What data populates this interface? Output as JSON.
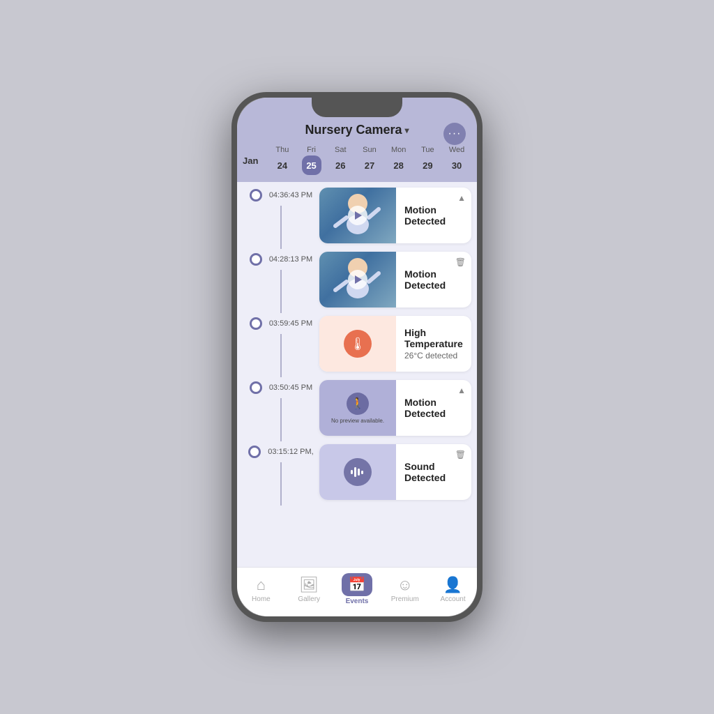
{
  "header": {
    "title": "Nursery Camera",
    "more_label": "•••"
  },
  "calendar": {
    "month": "Jan",
    "days": [
      {
        "name": "Thu",
        "num": "24",
        "active": false
      },
      {
        "name": "Fri",
        "num": "25",
        "active": true
      },
      {
        "name": "Sat",
        "num": "26",
        "active": false
      },
      {
        "name": "Sun",
        "num": "27",
        "active": false
      },
      {
        "name": "Mon",
        "num": "28",
        "active": false
      },
      {
        "name": "Tue",
        "num": "29",
        "active": false
      },
      {
        "name": "Wed",
        "num": "30",
        "active": false
      }
    ]
  },
  "events": [
    {
      "time": "04:36:43 PM",
      "type": "motion",
      "title": "Motion Detected",
      "has_video": true,
      "action": "▲"
    },
    {
      "time": "04:28:13 PM",
      "type": "motion",
      "title": "Motion Detected",
      "has_video": true,
      "action": "🗑"
    },
    {
      "time": "03:59:45 PM",
      "type": "temperature",
      "title": "High Temperature",
      "subtitle": "26°C detected",
      "has_video": false,
      "action": ""
    },
    {
      "time": "03:50:45 PM",
      "type": "motion_no_preview",
      "title": "Motion Detected",
      "has_video": false,
      "action": "▲",
      "no_preview": "No preview available."
    },
    {
      "time": "03:15:12 PM,",
      "type": "sound",
      "title": "Sound Detected",
      "has_video": false,
      "action": "🗑"
    }
  ],
  "bottom_nav": [
    {
      "label": "Home",
      "icon": "🏠",
      "active": false
    },
    {
      "label": "Gallery",
      "icon": "🖼",
      "active": false
    },
    {
      "label": "Events",
      "icon": "📅",
      "active": true
    },
    {
      "label": "Premium",
      "icon": "😊",
      "active": false
    },
    {
      "label": "Account",
      "icon": "👤",
      "active": false
    }
  ]
}
